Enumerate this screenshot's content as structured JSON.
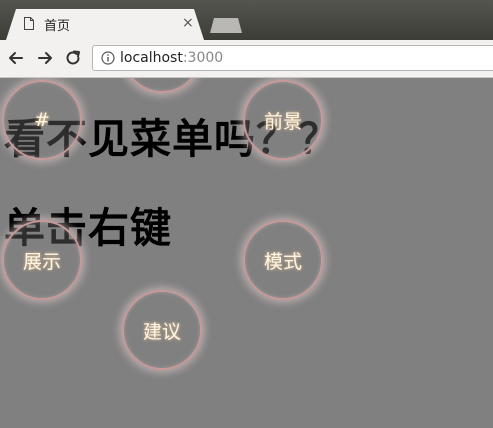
{
  "browser": {
    "tab_title": "首页",
    "tab_close": "×",
    "url_host": "localhost",
    "url_port": ":3000"
  },
  "page": {
    "heading1": "看不见菜单吗？？",
    "heading2": "单击右键"
  },
  "menu": {
    "items": [
      {
        "label": "#"
      },
      {
        "label": "前景"
      },
      {
        "label": "展示"
      },
      {
        "label": "模式"
      },
      {
        "label": "建议"
      },
      {
        "label": ""
      }
    ]
  },
  "colors": {
    "page_background": "#808080",
    "menu_ring": "#c79a9a",
    "menu_text": "#fff6e6"
  }
}
